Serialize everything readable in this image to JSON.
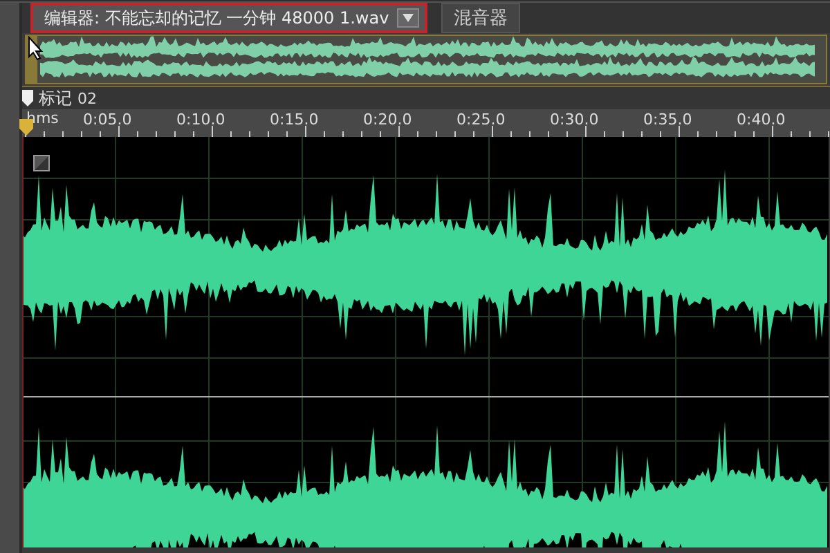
{
  "tabs": [
    {
      "label": "编辑器: 不能忘却的记忆  一分钟 48000 1.wav",
      "selected": true,
      "has_dropdown": true
    },
    {
      "label": "混音器",
      "selected": false,
      "has_dropdown": false
    }
  ],
  "marker_bar": {
    "label": "标记",
    "value": "02"
  },
  "ruler": {
    "unit": "hms",
    "ticks": [
      "0:05.0",
      "0:10.0",
      "0:15.0",
      "0:20.0",
      "0:25.0",
      "0:30.0",
      "0:35.0",
      "0:40.0"
    ]
  }
}
